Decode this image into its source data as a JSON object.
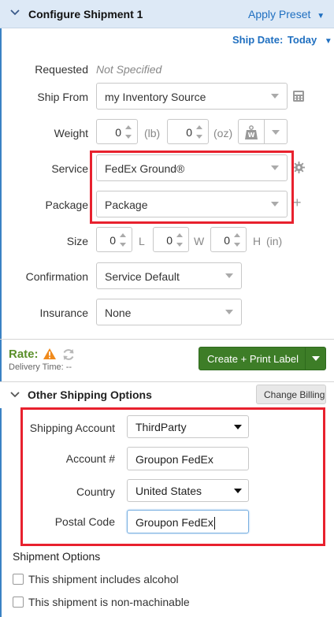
{
  "header": {
    "title": "Configure Shipment 1",
    "apply_preset": "Apply Preset"
  },
  "ship_date": {
    "label": "Ship Date:",
    "value": "Today"
  },
  "fields": {
    "requested": {
      "label": "Requested",
      "value": "Not Specified"
    },
    "ship_from": {
      "label": "Ship From",
      "value": "my Inventory Source"
    },
    "weight": {
      "label": "Weight",
      "lb_value": "0",
      "lb_unit": "(lb)",
      "oz_value": "0",
      "oz_unit": "(oz)"
    },
    "service": {
      "label": "Service",
      "value": "FedEx Ground®"
    },
    "package": {
      "label": "Package",
      "value": "Package"
    },
    "size": {
      "label": "Size",
      "l_value": "0",
      "l_unit": "L",
      "w_value": "0",
      "w_unit": "W",
      "h_value": "0",
      "h_unit": "H",
      "size_unit": "(in)"
    },
    "confirmation": {
      "label": "Confirmation",
      "value": "Service Default"
    },
    "insurance": {
      "label": "Insurance",
      "value": "None"
    }
  },
  "rate": {
    "label": "Rate:",
    "delivery_time": "Delivery Time:  --"
  },
  "create_button": "Create + Print Label",
  "other_shipping": {
    "title": "Other Shipping Options",
    "change_billing": "Change Billing",
    "shipping_account": {
      "label": "Shipping Account",
      "value": "ThirdParty"
    },
    "account_number": {
      "label": "Account #",
      "value": "Groupon FedEx"
    },
    "country": {
      "label": "Country",
      "value": "United States"
    },
    "postal_code": {
      "label": "Postal Code",
      "value": "Groupon FedEx"
    }
  },
  "shipment_options": {
    "title": "Shipment Options",
    "alcohol": "This shipment includes alcohol",
    "non_machinable": "This shipment is non-machinable"
  },
  "colors": {
    "accent_blue": "#1f6fc0",
    "header_bg": "#dde9f6",
    "create_green": "#3d7d27",
    "highlight_red": "#e8212e",
    "rate_green": "#5a8f2a",
    "warning_orange": "#f08a1c"
  }
}
